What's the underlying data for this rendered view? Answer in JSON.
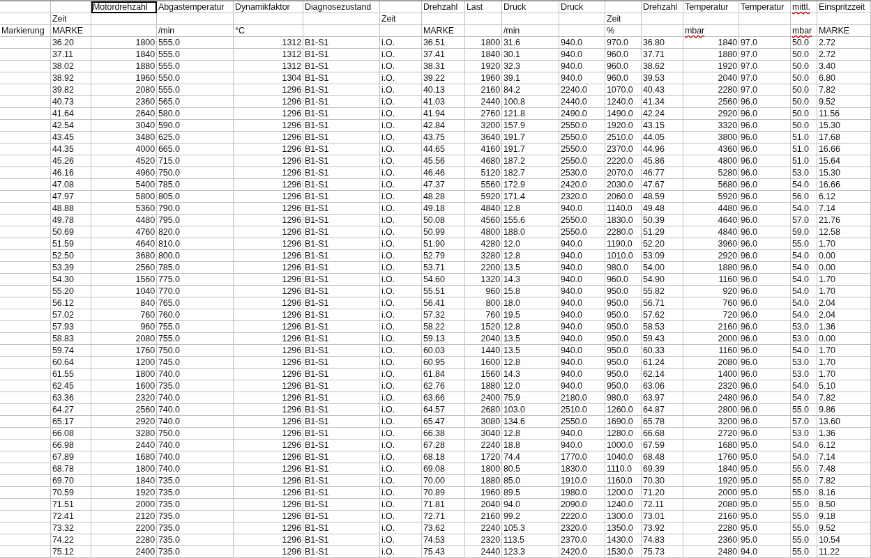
{
  "header_rows": [
    [
      null,
      null,
      {
        "text": "Motordrehzahl",
        "selected": true,
        "misspelled": false
      },
      {
        "text": "Abgastemperatur",
        "selected": false,
        "misspelled": false
      },
      {
        "text": "Dynamikfaktor",
        "selected": false,
        "misspelled": false
      },
      {
        "text": "Diagnosezustand",
        "selected": false,
        "misspelled": false
      },
      null,
      {
        "text": "Drehzahl",
        "selected": false,
        "misspelled": false
      },
      {
        "text": "Last",
        "selected": false,
        "misspelled": false
      },
      {
        "text": "Druck",
        "selected": false,
        "misspelled": false
      },
      {
        "text": "Druck",
        "selected": false,
        "misspelled": false
      },
      null,
      {
        "text": "Drehzahl",
        "selected": false,
        "misspelled": false
      },
      {
        "text": "Temperatur",
        "selected": false,
        "misspelled": false
      },
      {
        "text": "Temperatur",
        "selected": false,
        "misspelled": false
      },
      {
        "text": "mittl.",
        "selected": false,
        "misspelled": true
      },
      {
        "text": "Einspritzzeit",
        "selected": false,
        "misspelled": false
      }
    ],
    [
      null,
      {
        "text": "Zeit",
        "selected": false,
        "misspelled": false
      },
      null,
      null,
      null,
      null,
      {
        "text": "Zeit",
        "selected": false,
        "misspelled": false
      },
      null,
      null,
      null,
      null,
      {
        "text": "Zeit",
        "selected": false,
        "misspelled": false
      },
      null,
      null,
      null,
      null,
      null
    ],
    [
      {
        "text": "Markierung",
        "selected": false,
        "misspelled": false
      },
      {
        "text": "MARKE",
        "selected": false,
        "misspelled": false
      },
      null,
      {
        "text": "/min",
        "selected": false,
        "misspelled": false
      },
      {
        "text": "°C",
        "selected": false,
        "misspelled": false
      },
      null,
      null,
      {
        "text": "MARKE",
        "selected": false,
        "misspelled": false
      },
      null,
      {
        "text": "/min",
        "selected": false,
        "misspelled": false
      },
      null,
      {
        "text": "%",
        "selected": false,
        "misspelled": false
      },
      null,
      {
        "text": "mbar",
        "selected": false,
        "misspelled": true
      },
      null,
      {
        "text": "mbar",
        "selected": false,
        "misspelled": true
      },
      {
        "text": "MARKE",
        "selected": false,
        "misspelled": false
      }
    ]
  ],
  "rows": [
    [
      "36.20",
      "1800",
      "555.0",
      "1312",
      "B1-S1",
      "i.O.",
      "36.51",
      "1800",
      "31.6",
      "940.0",
      "970.0",
      "36.80",
      "1840",
      "97.0",
      "50.0",
      "2.72"
    ],
    [
      "37.11",
      "1840",
      "555.0",
      "1312",
      "B1-S1",
      "i.O.",
      "37.41",
      "1840",
      "30.1",
      "940.0",
      "960.0",
      "37.71",
      "1880",
      "97.0",
      "50.0",
      "2.72"
    ],
    [
      "38.02",
      "1880",
      "555.0",
      "1312",
      "B1-S1",
      "i.O.",
      "38.31",
      "1920",
      "32.3",
      "940.0",
      "960.0",
      "38.62",
      "1920",
      "97.0",
      "50.0",
      "3.40"
    ],
    [
      "38.92",
      "1960",
      "550.0",
      "1304",
      "B1-S1",
      "i.O.",
      "39.22",
      "1960",
      "39.1",
      "940.0",
      "960.0",
      "39.53",
      "2040",
      "97.0",
      "50.0",
      "6.80"
    ],
    [
      "39.82",
      "2080",
      "555.0",
      "1296",
      "B1-S1",
      "i.O.",
      "40.13",
      "2160",
      "84.2",
      "2240.0",
      "1070.0",
      "40.43",
      "2280",
      "97.0",
      "50.0",
      "7.82"
    ],
    [
      "40.73",
      "2360",
      "565.0",
      "1296",
      "B1-S1",
      "i.O.",
      "41.03",
      "2440",
      "100.8",
      "2440.0",
      "1240.0",
      "41.34",
      "2560",
      "96.0",
      "50.0",
      "9.52"
    ],
    [
      "41.64",
      "2640",
      "580.0",
      "1296",
      "B1-S1",
      "i.O.",
      "41.94",
      "2760",
      "121.8",
      "2490.0",
      "1490.0",
      "42.24",
      "2920",
      "96.0",
      "50.0",
      "11.56"
    ],
    [
      "42.54",
      "3040",
      "590.0",
      "1296",
      "B1-S1",
      "i.O.",
      "42.84",
      "3200",
      "157.9",
      "2550.0",
      "1920.0",
      "43.15",
      "3320",
      "96.0",
      "50.0",
      "15.30"
    ],
    [
      "43.45",
      "3480",
      "625.0",
      "1296",
      "B1-S1",
      "i.O.",
      "43.75",
      "3640",
      "191.7",
      "2550.0",
      "2510.0",
      "44.05",
      "3800",
      "96.0",
      "51.0",
      "17.68"
    ],
    [
      "44.35",
      "4000",
      "665.0",
      "1296",
      "B1-S1",
      "i.O.",
      "44.65",
      "4160",
      "191.7",
      "2550.0",
      "2370.0",
      "44.96",
      "4360",
      "96.0",
      "51.0",
      "16.66"
    ],
    [
      "45.26",
      "4520",
      "715.0",
      "1296",
      "B1-S1",
      "i.O.",
      "45.56",
      "4680",
      "187.2",
      "2550.0",
      "2220.0",
      "45.86",
      "4800",
      "96.0",
      "51.0",
      "15.64"
    ],
    [
      "46.16",
      "4960",
      "750.0",
      "1296",
      "B1-S1",
      "i.O.",
      "46.46",
      "5120",
      "182.7",
      "2530.0",
      "2070.0",
      "46.77",
      "5280",
      "96.0",
      "53.0",
      "15.30"
    ],
    [
      "47.08",
      "5400",
      "785.0",
      "1296",
      "B1-S1",
      "i.O.",
      "47.37",
      "5560",
      "172.9",
      "2420.0",
      "2030.0",
      "47.67",
      "5680",
      "96.0",
      "54.0",
      "16.66"
    ],
    [
      "47.97",
      "5800",
      "805.0",
      "1296",
      "B1-S1",
      "i.O.",
      "48.28",
      "5920",
      "171.4",
      "2320.0",
      "2060.0",
      "48.59",
      "5920",
      "96.0",
      "56.0",
      "6.12"
    ],
    [
      "48.88",
      "5360",
      "790.0",
      "1296",
      "B1-S1",
      "i.O.",
      "49.18",
      "4840",
      "12.8",
      "940.0",
      "1140.0",
      "49.48",
      "4480",
      "96.0",
      "54.0",
      "7.14"
    ],
    [
      "49.78",
      "4480",
      "795.0",
      "1296",
      "B1-S1",
      "i.O.",
      "50.08",
      "4560",
      "155.6",
      "2550.0",
      "1830.0",
      "50.39",
      "4640",
      "96.0",
      "57.0",
      "21.76"
    ],
    [
      "50.69",
      "4760",
      "820.0",
      "1296",
      "B1-S1",
      "i.O.",
      "50.99",
      "4800",
      "188.0",
      "2550.0",
      "2280.0",
      "51.29",
      "4840",
      "96.0",
      "59.0",
      "12.58"
    ],
    [
      "51.59",
      "4640",
      "810.0",
      "1296",
      "B1-S1",
      "i.O.",
      "51.90",
      "4280",
      "12.0",
      "940.0",
      "1190.0",
      "52.20",
      "3960",
      "96.0",
      "55.0",
      "1.70"
    ],
    [
      "52.50",
      "3680",
      "800.0",
      "1296",
      "B1-S1",
      "i.O.",
      "52.79",
      "3280",
      "12.8",
      "940.0",
      "1010.0",
      "53.09",
      "2920",
      "96.0",
      "54.0",
      "0.00"
    ],
    [
      "53.39",
      "2560",
      "785.0",
      "1296",
      "B1-S1",
      "i.O.",
      "53.71",
      "2200",
      "13.5",
      "940.0",
      "980.0",
      "54.00",
      "1880",
      "96.0",
      "54.0",
      "0.00"
    ],
    [
      "54.30",
      "1560",
      "775.0",
      "1296",
      "B1-S1",
      "i.O.",
      "54.60",
      "1320",
      "14.3",
      "940.0",
      "960.0",
      "54.90",
      "1160",
      "96.0",
      "54.0",
      "1.70"
    ],
    [
      "55.20",
      "1040",
      "770.0",
      "1296",
      "B1-S1",
      "i.O.",
      "55.51",
      "960",
      "15.8",
      "940.0",
      "950.0",
      "55.82",
      "920",
      "96.0",
      "54.0",
      "1.70"
    ],
    [
      "56.12",
      "840",
      "765.0",
      "1296",
      "B1-S1",
      "i.O.",
      "56.41",
      "800",
      "18.0",
      "940.0",
      "950.0",
      "56.71",
      "760",
      "96.0",
      "54.0",
      "2.04"
    ],
    [
      "57.02",
      "760",
      "760.0",
      "1296",
      "B1-S1",
      "i.O.",
      "57.32",
      "760",
      "19.5",
      "940.0",
      "950.0",
      "57.62",
      "720",
      "96.0",
      "54.0",
      "2.04"
    ],
    [
      "57.93",
      "960",
      "755.0",
      "1296",
      "B1-S1",
      "i.O.",
      "58.22",
      "1520",
      "12.8",
      "940.0",
      "950.0",
      "58.53",
      "2160",
      "96.0",
      "53.0",
      "1.36"
    ],
    [
      "58.83",
      "2080",
      "755.0",
      "1296",
      "B1-S1",
      "i.O.",
      "59.13",
      "2040",
      "13.5",
      "940.0",
      "950.0",
      "59.43",
      "2000",
      "96.0",
      "53.0",
      "0.00"
    ],
    [
      "59.74",
      "1760",
      "750.0",
      "1296",
      "B1-S1",
      "i.O.",
      "60.03",
      "1440",
      "13.5",
      "940.0",
      "950.0",
      "60.33",
      "1160",
      "96.0",
      "54.0",
      "1.70"
    ],
    [
      "60.64",
      "1200",
      "745.0",
      "1296",
      "B1-S1",
      "i.O.",
      "60.95",
      "1600",
      "12.8",
      "940.0",
      "950.0",
      "61.24",
      "2080",
      "96.0",
      "53.0",
      "1.70"
    ],
    [
      "61.55",
      "1800",
      "740.0",
      "1296",
      "B1-S1",
      "i.O.",
      "61.84",
      "1560",
      "14.3",
      "940.0",
      "950.0",
      "62.14",
      "1400",
      "96.0",
      "53.0",
      "1.70"
    ],
    [
      "62.45",
      "1600",
      "735.0",
      "1296",
      "B1-S1",
      "i.O.",
      "62.76",
      "1880",
      "12.0",
      "940.0",
      "950.0",
      "63.06",
      "2320",
      "96.0",
      "54.0",
      "5.10"
    ],
    [
      "63.36",
      "2320",
      "740.0",
      "1296",
      "B1-S1",
      "i.O.",
      "63.66",
      "2400",
      "75.9",
      "2180.0",
      "980.0",
      "63.97",
      "2480",
      "96.0",
      "54.0",
      "7.82"
    ],
    [
      "64.27",
      "2560",
      "740.0",
      "1296",
      "B1-S1",
      "i.O.",
      "64.57",
      "2680",
      "103.0",
      "2510.0",
      "1260.0",
      "64.87",
      "2800",
      "96.0",
      "55.0",
      "9.86"
    ],
    [
      "65.17",
      "2920",
      "740.0",
      "1296",
      "B1-S1",
      "i.O.",
      "65.47",
      "3080",
      "134.6",
      "2550.0",
      "1690.0",
      "65.78",
      "3200",
      "96.0",
      "57.0",
      "13.60"
    ],
    [
      "66.08",
      "3280",
      "750.0",
      "1296",
      "B1-S1",
      "i.O.",
      "66.38",
      "3040",
      "12.8",
      "940.0",
      "1280.0",
      "66.68",
      "2720",
      "96.0",
      "53.0",
      "1.36"
    ],
    [
      "66.98",
      "2440",
      "740.0",
      "1296",
      "B1-S1",
      "i.O.",
      "67.28",
      "2240",
      "18.8",
      "940.0",
      "1000.0",
      "67.59",
      "1680",
      "95.0",
      "54.0",
      "6.12"
    ],
    [
      "67.89",
      "1680",
      "740.0",
      "1296",
      "B1-S1",
      "i.O.",
      "68.18",
      "1720",
      "74.4",
      "1770.0",
      "1040.0",
      "68.48",
      "1760",
      "95.0",
      "54.0",
      "7.14"
    ],
    [
      "68.78",
      "1800",
      "740.0",
      "1296",
      "B1-S1",
      "i.O.",
      "69.08",
      "1800",
      "80.5",
      "1830.0",
      "1110.0",
      "69.39",
      "1840",
      "95.0",
      "55.0",
      "7.48"
    ],
    [
      "69.70",
      "1840",
      "735.0",
      "1296",
      "B1-S1",
      "i.O.",
      "70.00",
      "1880",
      "85.0",
      "1910.0",
      "1160.0",
      "70.30",
      "1920",
      "95.0",
      "55.0",
      "7.82"
    ],
    [
      "70.59",
      "1920",
      "735.0",
      "1296",
      "B1-S1",
      "i.O.",
      "70.89",
      "1960",
      "89.5",
      "1980.0",
      "1200.0",
      "71.20",
      "2000",
      "95.0",
      "55.0",
      "8.16"
    ],
    [
      "71.51",
      "2000",
      "735.0",
      "1296",
      "B1-S1",
      "i.O.",
      "71.81",
      "2040",
      "94.0",
      "2090.0",
      "1240.0",
      "72.11",
      "2080",
      "95.0",
      "55.0",
      "8.50"
    ],
    [
      "72.41",
      "2120",
      "735.0",
      "1296",
      "B1-S1",
      "i.O.",
      "72.71",
      "2160",
      "99.2",
      "2220.0",
      "1300.0",
      "73.01",
      "2160",
      "95.0",
      "55.0",
      "9.18"
    ],
    [
      "73.32",
      "2200",
      "735.0",
      "1296",
      "B1-S1",
      "i.O.",
      "73.62",
      "2240",
      "105.3",
      "2320.0",
      "1350.0",
      "73.92",
      "2280",
      "95.0",
      "55.0",
      "9.52"
    ],
    [
      "74.22",
      "2280",
      "735.0",
      "1296",
      "B1-S1",
      "i.O.",
      "74.53",
      "2320",
      "113.5",
      "2370.0",
      "1430.0",
      "74.83",
      "2360",
      "95.0",
      "55.0",
      "10.54"
    ],
    [
      "75.12",
      "2400",
      "735.0",
      "1296",
      "B1-S1",
      "i.O.",
      "75.43",
      "2440",
      "123.3",
      "2420.0",
      "1530.0",
      "75.73",
      "2480",
      "94.0",
      "55.0",
      "11.22"
    ]
  ]
}
